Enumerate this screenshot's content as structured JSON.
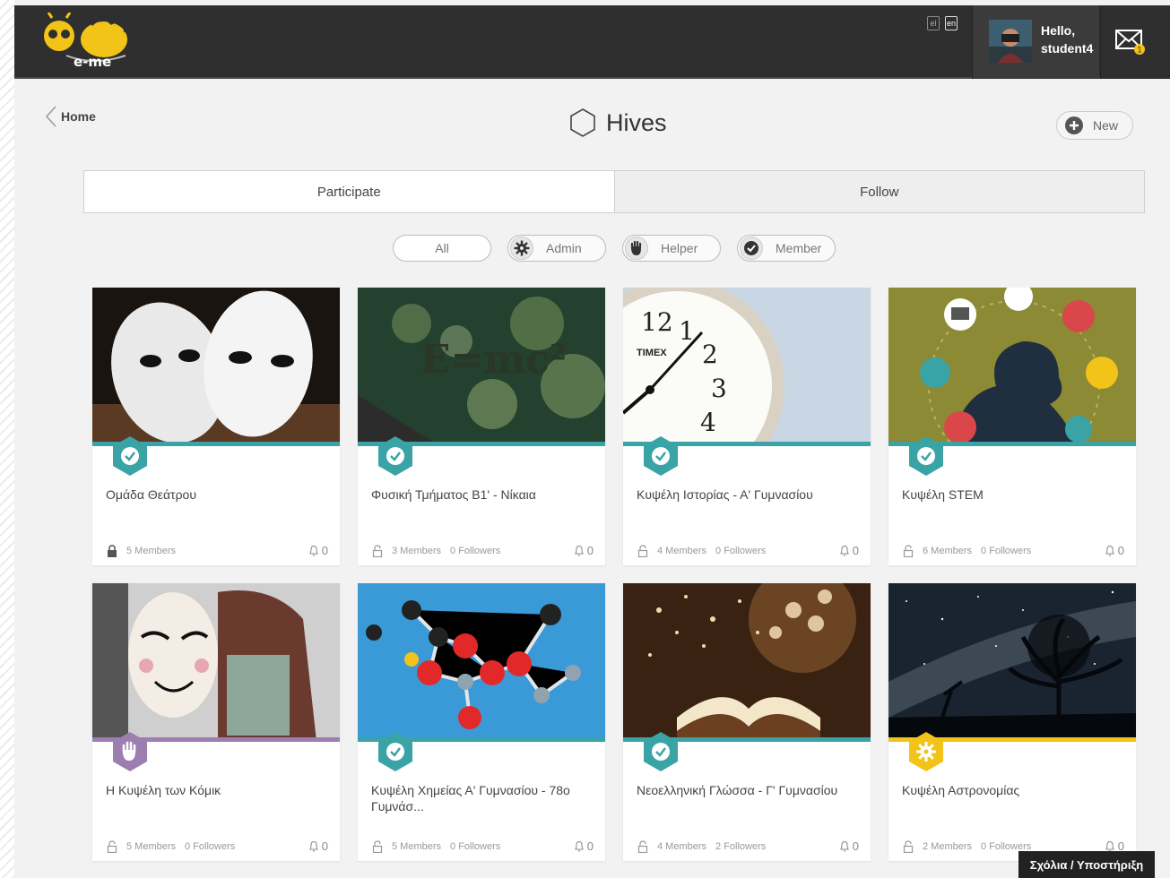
{
  "app": {
    "logo_text": "e-me",
    "languages": [
      "el",
      "en"
    ],
    "user": {
      "greeting": "Hello,",
      "name": "student4"
    },
    "mail_count": "1"
  },
  "header": {
    "back_label": "Home",
    "title": "Hives",
    "new_label": "New"
  },
  "tabs": [
    {
      "label": "Participate",
      "active": true
    },
    {
      "label": "Follow",
      "active": false
    }
  ],
  "filters": [
    "All",
    "Admin",
    "Helper",
    "Member"
  ],
  "cards": [
    {
      "title": "Ομάδα Θεάτρου",
      "members": "5 Members",
      "followers": "",
      "notifications": "0",
      "role": "member",
      "bar_color": "#3aa3a6",
      "image": "masks",
      "locked": true
    },
    {
      "title": "Φυσική Τμήματος Β1' - Νίκαια",
      "members": "3 Members",
      "followers": "0 Followers",
      "notifications": "0",
      "role": "member",
      "bar_color": "#3aa3a6",
      "image": "physics",
      "locked": false
    },
    {
      "title": "Κυψέλη Ιστορίας - Α' Γυμνασίου",
      "members": "4 Members",
      "followers": "0 Followers",
      "notifications": "0",
      "role": "member",
      "bar_color": "#3aa3a6",
      "image": "clock",
      "locked": false
    },
    {
      "title": "Κυψέλη STEM",
      "members": "6 Members",
      "followers": "0 Followers",
      "notifications": "0",
      "role": "member",
      "bar_color": "#3aa3a6",
      "image": "stem",
      "locked": false
    },
    {
      "title": "Η Κυψέλη των Κόμικ",
      "members": "5 Members",
      "followers": "0 Followers",
      "notifications": "0",
      "role": "helper",
      "bar_color": "#9d7eb0",
      "image": "comic",
      "locked": false
    },
    {
      "title": "Κυψέλη Χημείας Α' Γυμνασίου - 78ο Γυμνάσ...",
      "members": "5 Members",
      "followers": "0 Followers",
      "notifications": "0",
      "role": "member",
      "bar_color": "#3aa3a6",
      "image": "molecule",
      "locked": false
    },
    {
      "title": "Νεοελληνική Γλώσσα - Γ' Γυμνασίου",
      "members": "4 Members",
      "followers": "2 Followers",
      "notifications": "0",
      "role": "member",
      "bar_color": "#3aa3a6",
      "image": "book",
      "locked": false
    },
    {
      "title": "Κυψέλη Αστρονομίας",
      "members": "2 Members",
      "followers": "0 Followers",
      "notifications": "0",
      "role": "admin",
      "bar_color": "#f2c318",
      "image": "stars",
      "locked": false
    }
  ],
  "feedback_label": "Σχόλια / Υποστήριξη"
}
